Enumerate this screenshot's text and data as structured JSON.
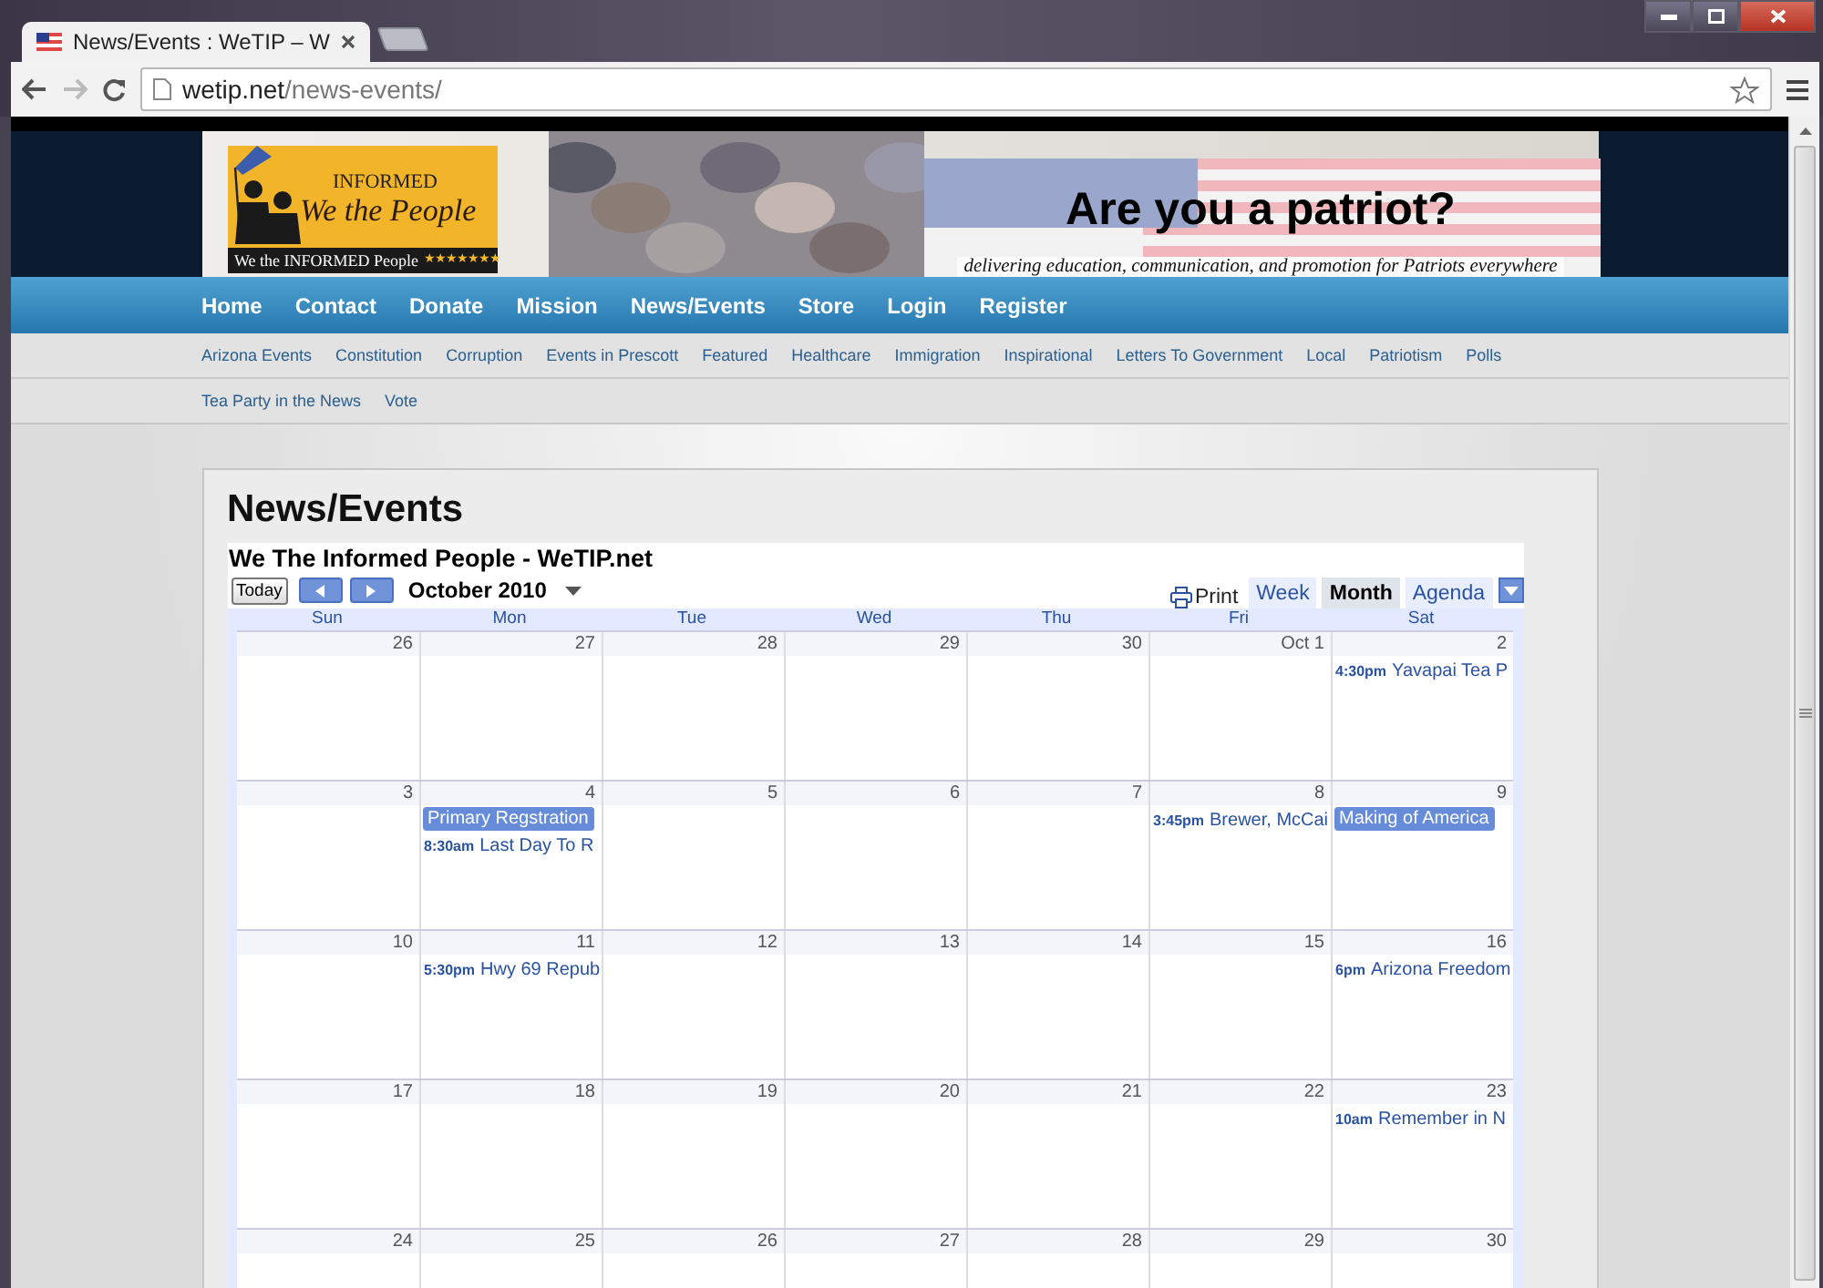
{
  "browser": {
    "tabs": [
      {
        "title": "News/Events : WeTIP – W",
        "selected": true
      }
    ],
    "url_host": "wetip.net",
    "url_path": "/news-events/"
  },
  "banner": {
    "logo_top": "INFORMED",
    "logo_main": "We the People",
    "logo_bottom": "We the INFORMED People",
    "logo_stars": "★★★★★★★",
    "headline": "Are you a patriot?",
    "tagline": "delivering education, communication, and promotion for Patriots everywhere"
  },
  "nav": [
    "Home",
    "Contact",
    "Donate",
    "Mission",
    "News/Events",
    "Store",
    "Login",
    "Register"
  ],
  "categories": [
    "Arizona Events",
    "Constitution",
    "Corruption",
    "Events in Prescott",
    "Featured",
    "Healthcare",
    "Immigration",
    "Inspirational",
    "Letters To Government",
    "Local",
    "Patriotism",
    "Polls",
    "Tea Party in the News",
    "Vote"
  ],
  "page_title": "News/Events",
  "calendar": {
    "title": "We The Informed People - WeTIP.net",
    "today_button": "Today",
    "month": "October 2010",
    "print": "Print",
    "views": [
      {
        "label": "Week",
        "selected": false
      },
      {
        "label": "Month",
        "selected": true
      },
      {
        "label": "Agenda",
        "selected": false
      }
    ],
    "weekdays": [
      "Sun",
      "Mon",
      "Tue",
      "Wed",
      "Thu",
      "Fri",
      "Sat"
    ],
    "weeks": [
      [
        {
          "date": "26"
        },
        {
          "date": "27"
        },
        {
          "date": "28"
        },
        {
          "date": "29"
        },
        {
          "date": "30"
        },
        {
          "date": "Oct 1"
        },
        {
          "date": "2",
          "events": [
            {
              "kind": "timed",
              "time": "4:30pm",
              "title": "Yavapai Tea P"
            }
          ]
        }
      ],
      [
        {
          "date": "3"
        },
        {
          "date": "4",
          "events": [
            {
              "kind": "allday",
              "title": "Primary Regstration"
            },
            {
              "kind": "timed",
              "time": "8:30am",
              "title": "Last Day To R"
            }
          ]
        },
        {
          "date": "5"
        },
        {
          "date": "6"
        },
        {
          "date": "7"
        },
        {
          "date": "8",
          "events": [
            {
              "kind": "timed",
              "time": "3:45pm",
              "title": "Brewer, McCai"
            }
          ]
        },
        {
          "date": "9",
          "events": [
            {
              "kind": "allday",
              "title": "Making of America"
            }
          ]
        }
      ],
      [
        {
          "date": "10"
        },
        {
          "date": "11",
          "events": [
            {
              "kind": "timed",
              "time": "5:30pm",
              "title": "Hwy 69 Repub"
            }
          ]
        },
        {
          "date": "12"
        },
        {
          "date": "13"
        },
        {
          "date": "14"
        },
        {
          "date": "15"
        },
        {
          "date": "16",
          "events": [
            {
              "kind": "timed",
              "time": "6pm",
              "title": "Arizona Freedom"
            }
          ]
        }
      ],
      [
        {
          "date": "17"
        },
        {
          "date": "18"
        },
        {
          "date": "19"
        },
        {
          "date": "20"
        },
        {
          "date": "21"
        },
        {
          "date": "22"
        },
        {
          "date": "23",
          "events": [
            {
              "kind": "timed",
              "time": "10am",
              "title": "Remember in N"
            }
          ]
        }
      ],
      [
        {
          "date": "24"
        },
        {
          "date": "25"
        },
        {
          "date": "26"
        },
        {
          "date": "27"
        },
        {
          "date": "28"
        },
        {
          "date": "29"
        },
        {
          "date": "30"
        }
      ]
    ]
  }
}
